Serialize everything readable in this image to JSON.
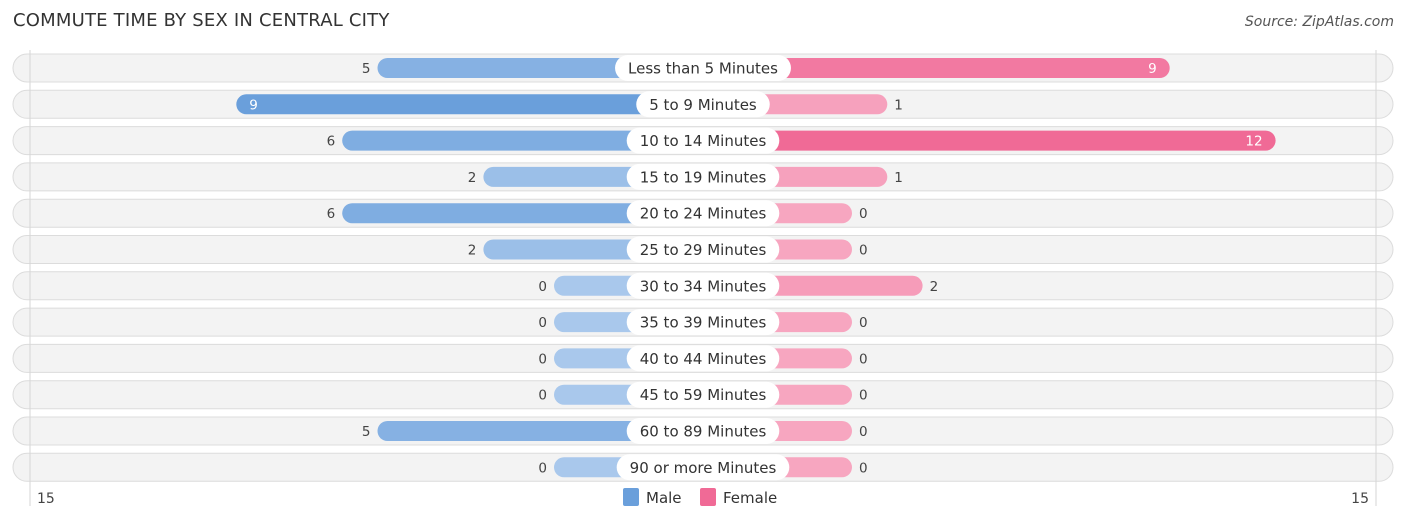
{
  "title": "COMMUTE TIME BY SEX IN CENTRAL CITY",
  "source": "Source: ZipAtlas.com",
  "colors": {
    "male_strong": "#6a9fdb",
    "male_light": "#a9c8ec",
    "female_strong": "#f06a96",
    "female_light": "#f7a6c0"
  },
  "chart_data": {
    "type": "bar",
    "orientation": "horizontal-diverging",
    "title": "COMMUTE TIME BY SEX IN CENTRAL CITY",
    "categories": [
      "Less than 5 Minutes",
      "5 to 9 Minutes",
      "10 to 14 Minutes",
      "15 to 19 Minutes",
      "20 to 24 Minutes",
      "25 to 29 Minutes",
      "30 to 34 Minutes",
      "35 to 39 Minutes",
      "40 to 44 Minutes",
      "45 to 59 Minutes",
      "60 to 89 Minutes",
      "90 or more Minutes"
    ],
    "series": [
      {
        "name": "Male",
        "values": [
          5,
          9,
          6,
          2,
          6,
          2,
          0,
          0,
          0,
          0,
          5,
          0
        ]
      },
      {
        "name": "Female",
        "values": [
          9,
          1,
          12,
          1,
          0,
          0,
          2,
          0,
          0,
          0,
          0,
          0
        ]
      }
    ],
    "axis": {
      "left_max": 15,
      "right_max": 15,
      "left_label": "15",
      "right_label": "15"
    },
    "legend": {
      "position": "bottom-center",
      "entries": [
        "Male",
        "Female"
      ]
    },
    "grid": false
  }
}
